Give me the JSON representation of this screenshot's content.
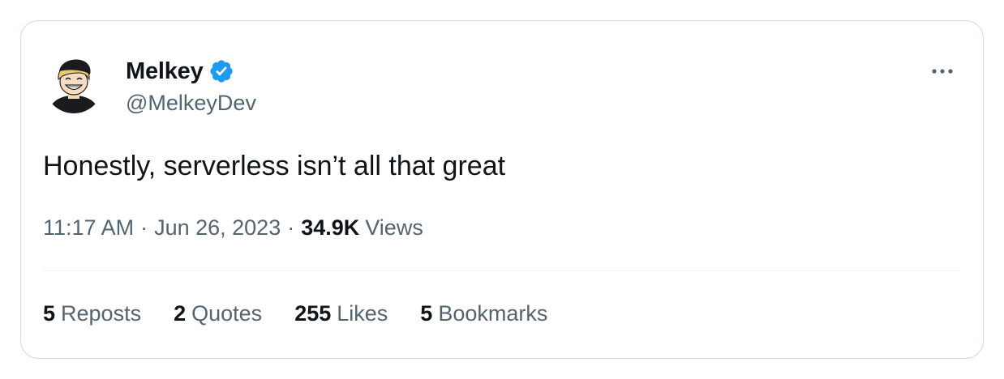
{
  "author": {
    "display_name": "Melkey",
    "handle": "@MelkeyDev",
    "verified": true,
    "verified_color": "#1d9bf0",
    "avatar_icon": "cartoon-avatar"
  },
  "tweet": {
    "text": "Honestly, serverless isn’t all that great",
    "time": "11:17 AM",
    "date": "Jun 26, 2023",
    "views_count": "34.9K",
    "views_label": "Views",
    "separator": "·"
  },
  "stats": [
    {
      "count": "5",
      "label": "Reposts"
    },
    {
      "count": "2",
      "label": "Quotes"
    },
    {
      "count": "255",
      "label": "Likes"
    },
    {
      "count": "5",
      "label": "Bookmarks"
    }
  ],
  "colors": {
    "primary_text": "#0f1419",
    "secondary_text": "#536471",
    "border": "#cfd9de",
    "divider": "#eff3f4"
  },
  "icons": {
    "more": "more-horizontal-icon",
    "verified": "verified-badge-icon"
  }
}
